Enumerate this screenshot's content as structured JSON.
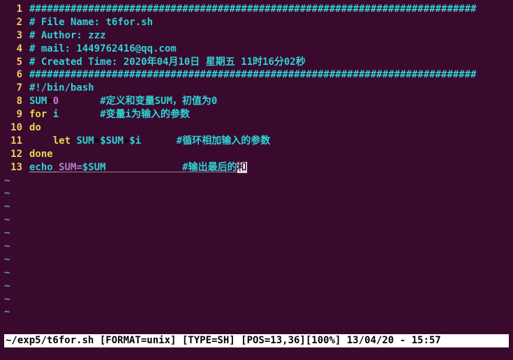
{
  "lines": [
    {
      "n": "1",
      "segs": [
        {
          "cls": "comment",
          "t": "############################################################################"
        }
      ]
    },
    {
      "n": "2",
      "segs": [
        {
          "cls": "comment",
          "t": "# File Name: t6for.sh"
        }
      ]
    },
    {
      "n": "3",
      "segs": [
        {
          "cls": "comment",
          "t": "# Author: zzz"
        }
      ]
    },
    {
      "n": "4",
      "segs": [
        {
          "cls": "comment",
          "t": "# mail: 1449762416@qq.com"
        }
      ]
    },
    {
      "n": "5",
      "segs": [
        {
          "cls": "comment",
          "t": "# Created Time: 2020年04月10日 星期五 11时16分02秒"
        }
      ]
    },
    {
      "n": "6",
      "segs": [
        {
          "cls": "comment",
          "t": "############################################################################"
        }
      ]
    },
    {
      "n": "7",
      "segs": [
        {
          "cls": "comment",
          "t": "#!/bin/bash"
        }
      ]
    },
    {
      "n": "8",
      "segs": [
        {
          "cls": "ident",
          "t": "SUM"
        },
        {
          "cls": "",
          "t": "="
        },
        {
          "cls": "number",
          "t": "0"
        },
        {
          "cls": "",
          "t": "       "
        },
        {
          "cls": "comment",
          "t": "#定义和变量SUM，初值为0"
        }
      ]
    },
    {
      "n": "9",
      "segs": [
        {
          "cls": "keyword",
          "t": "for"
        },
        {
          "cls": "",
          "t": " "
        },
        {
          "cls": "ident",
          "t": "i"
        },
        {
          "cls": "",
          "t": "       "
        },
        {
          "cls": "comment",
          "t": "#变量i为输入的参数"
        }
      ]
    },
    {
      "n": "10",
      "segs": [
        {
          "cls": "keyword",
          "t": "do"
        }
      ]
    },
    {
      "n": "11",
      "segs": [
        {
          "cls": "",
          "t": "    "
        },
        {
          "cls": "keyword",
          "t": "let"
        },
        {
          "cls": "",
          "t": " "
        },
        {
          "cls": "ident",
          "t": "SUM"
        },
        {
          "cls": "",
          "t": "="
        },
        {
          "cls": "var",
          "t": "$SUM"
        },
        {
          "cls": "",
          "t": "+"
        },
        {
          "cls": "var",
          "t": "$i"
        },
        {
          "cls": "",
          "t": "      "
        },
        {
          "cls": "comment",
          "t": "#循环相加输入的参数"
        }
      ]
    },
    {
      "n": "12",
      "segs": [
        {
          "cls": "keyword",
          "t": "done"
        }
      ]
    },
    {
      "n": "13",
      "segs": [
        {
          "cls": "echo-kw",
          "t": "echo"
        },
        {
          "cls": "",
          "t": " "
        },
        {
          "cls": "echo-arg cursor-line",
          "t": "SUM="
        },
        {
          "cls": "var cursor-line",
          "t": "$SUM"
        },
        {
          "cls": "cursor-line",
          "t": "             "
        },
        {
          "cls": "comment cursor-line",
          "t": "#输出最后的"
        },
        {
          "cls": "comment cursor-ch",
          "t": "和"
        }
      ],
      "ul": true
    }
  ],
  "empty_rows": 11,
  "empty_marker": "~",
  "statusbar": "~/exp5/t6for.sh [FORMAT=unix] [TYPE=SH] [POS=13,36][100%] 13/04/20 - 15:57"
}
